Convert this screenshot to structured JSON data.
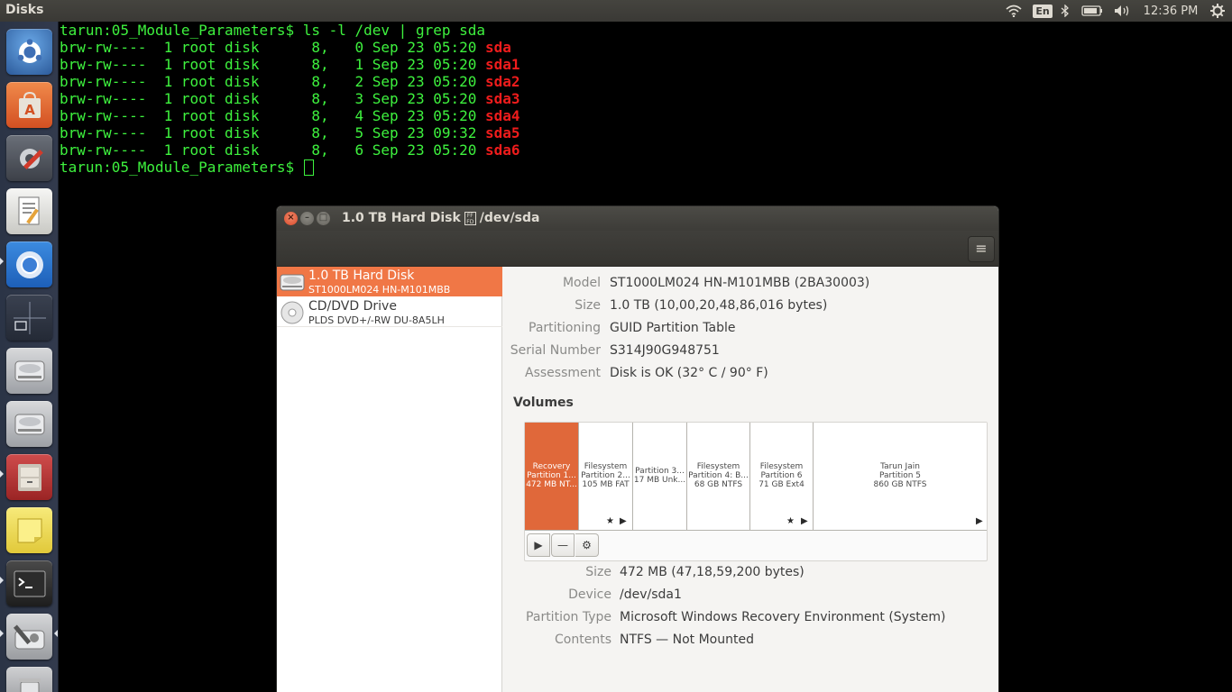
{
  "top_panel": {
    "app_title": "Disks",
    "language": "En",
    "clock": "12:36 PM"
  },
  "terminal": {
    "lines": [
      {
        "prefix": "tarun:05_Module_Parameters$ ls -l /dev | grep sda",
        "hl": "",
        "suffix": ""
      },
      {
        "prefix": "brw-rw----  1 root disk      8,   0 Sep 23 05:20 ",
        "hl": "sda",
        "suffix": ""
      },
      {
        "prefix": "brw-rw----  1 root disk      8,   1 Sep 23 05:20 ",
        "hl": "sda",
        "suffix": "1"
      },
      {
        "prefix": "brw-rw----  1 root disk      8,   2 Sep 23 05:20 ",
        "hl": "sda",
        "suffix": "2"
      },
      {
        "prefix": "brw-rw----  1 root disk      8,   3 Sep 23 05:20 ",
        "hl": "sda",
        "suffix": "3"
      },
      {
        "prefix": "brw-rw----  1 root disk      8,   4 Sep 23 05:20 ",
        "hl": "sda",
        "suffix": "4"
      },
      {
        "prefix": "brw-rw----  1 root disk      8,   5 Sep 23 09:32 ",
        "hl": "sda",
        "suffix": "5"
      },
      {
        "prefix": "brw-rw----  1 root disk      8,   6 Sep 23 05:20 ",
        "hl": "sda",
        "suffix": "6"
      }
    ],
    "prompt": "tarun:05_Module_Parameters$ "
  },
  "window": {
    "title": "1.0 TB Hard Disk",
    "title_path": "/dev/sda",
    "menu_icon": "hamburger-icon"
  },
  "drives": [
    {
      "name": "1.0 TB Hard Disk",
      "sub": "ST1000LM024 HN-M101MBB"
    },
    {
      "name": "CD/DVD Drive",
      "sub": "PLDS DVD+/-RW DU-8A5LH"
    }
  ],
  "disk_props": {
    "model_label": "Model",
    "model": "ST1000LM024 HN-M101MBB (2BA30003)",
    "size_label": "Size",
    "size": "1.0 TB (10,00,20,48,86,016 bytes)",
    "partitioning_label": "Partitioning",
    "partitioning": "GUID Partition Table",
    "serial_label": "Serial Number",
    "serial": "S314J90G948751",
    "assessment_label": "Assessment",
    "assessment": "Disk is OK (32° C / 90° F)"
  },
  "volumes_heading": "Volumes",
  "volumes": [
    {
      "l1": "Recovery",
      "l2": "Partition 1...",
      "l3": "472 MB NT..."
    },
    {
      "l1": "Filesystem",
      "l2": "Partition 2...",
      "l3": "105 MB FAT"
    },
    {
      "l1": "Partition 3...",
      "l2": "17 MB Unk..."
    },
    {
      "l1": "Filesystem",
      "l2": "Partition 4: B...",
      "l3": "68 GB NTFS"
    },
    {
      "l1": "Filesystem",
      "l2": "Partition 6",
      "l3": "71 GB Ext4"
    },
    {
      "l1": "Tarun Jain",
      "l2": "Partition 5",
      "l3": "860 GB NTFS"
    }
  ],
  "partition_props": {
    "size_label": "Size",
    "size": "472 MB (47,18,59,200 bytes)",
    "device_label": "Device",
    "device": "/dev/sda1",
    "type_label": "Partition Type",
    "type": "Microsoft Windows Recovery Environment (System)",
    "contents_label": "Contents",
    "contents": "NTFS — Not Mounted"
  },
  "colors": {
    "accent": "#f07746",
    "terminal_green": "#3ef23e",
    "terminal_red": "#ef1c1c"
  }
}
